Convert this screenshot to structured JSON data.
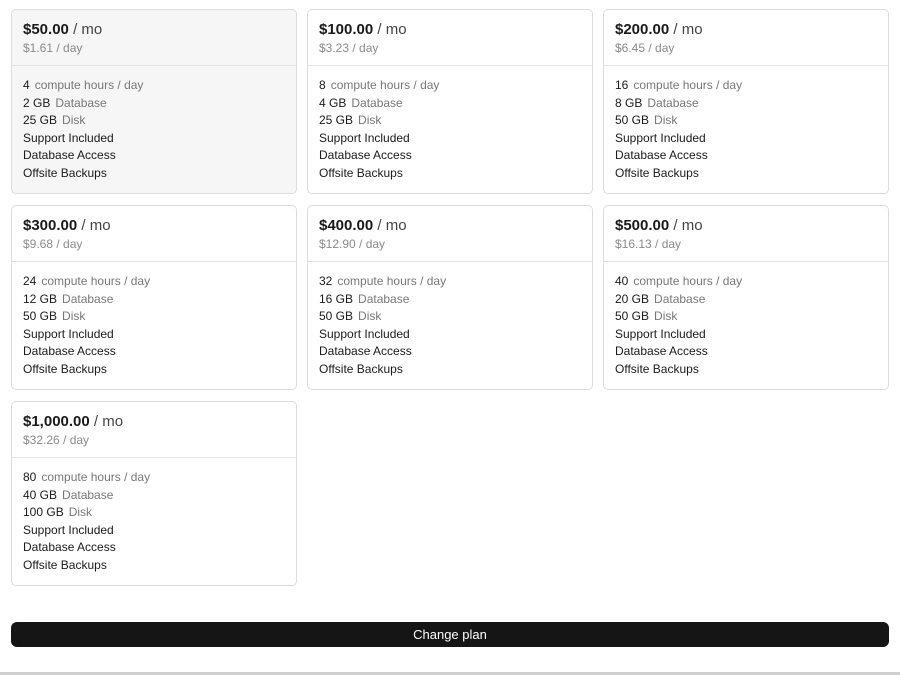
{
  "plans": [
    {
      "price": "$50.00",
      "per_month": "/ mo",
      "per_day": "$1.61 / day",
      "selected": true,
      "features": [
        {
          "value": "4",
          "label": "compute hours / day"
        },
        {
          "value": "2 GB",
          "label": "Database"
        },
        {
          "value": "25 GB",
          "label": "Disk"
        },
        {
          "text": "Support Included"
        },
        {
          "text": "Database Access"
        },
        {
          "text": "Offsite Backups"
        }
      ]
    },
    {
      "price": "$100.00",
      "per_month": "/ mo",
      "per_day": "$3.23 / day",
      "selected": false,
      "features": [
        {
          "value": "8",
          "label": "compute hours / day"
        },
        {
          "value": "4 GB",
          "label": "Database"
        },
        {
          "value": "25 GB",
          "label": "Disk"
        },
        {
          "text": "Support Included"
        },
        {
          "text": "Database Access"
        },
        {
          "text": "Offsite Backups"
        }
      ]
    },
    {
      "price": "$200.00",
      "per_month": "/ mo",
      "per_day": "$6.45 / day",
      "selected": false,
      "features": [
        {
          "value": "16",
          "label": "compute hours / day"
        },
        {
          "value": "8 GB",
          "label": "Database"
        },
        {
          "value": "50 GB",
          "label": "Disk"
        },
        {
          "text": "Support Included"
        },
        {
          "text": "Database Access"
        },
        {
          "text": "Offsite Backups"
        }
      ]
    },
    {
      "price": "$300.00",
      "per_month": "/ mo",
      "per_day": "$9.68 / day",
      "selected": false,
      "features": [
        {
          "value": "24",
          "label": "compute hours / day"
        },
        {
          "value": "12 GB",
          "label": "Database"
        },
        {
          "value": "50 GB",
          "label": "Disk"
        },
        {
          "text": "Support Included"
        },
        {
          "text": "Database Access"
        },
        {
          "text": "Offsite Backups"
        }
      ]
    },
    {
      "price": "$400.00",
      "per_month": "/ mo",
      "per_day": "$12.90 / day",
      "selected": false,
      "features": [
        {
          "value": "32",
          "label": "compute hours / day"
        },
        {
          "value": "16 GB",
          "label": "Database"
        },
        {
          "value": "50 GB",
          "label": "Disk"
        },
        {
          "text": "Support Included"
        },
        {
          "text": "Database Access"
        },
        {
          "text": "Offsite Backups"
        }
      ]
    },
    {
      "price": "$500.00",
      "per_month": "/ mo",
      "per_day": "$16.13 / day",
      "selected": false,
      "features": [
        {
          "value": "40",
          "label": "compute hours / day"
        },
        {
          "value": "20 GB",
          "label": "Database"
        },
        {
          "value": "50 GB",
          "label": "Disk"
        },
        {
          "text": "Support Included"
        },
        {
          "text": "Database Access"
        },
        {
          "text": "Offsite Backups"
        }
      ]
    },
    {
      "price": "$1,000.00",
      "per_month": "/ mo",
      "per_day": "$32.26 / day",
      "selected": false,
      "features": [
        {
          "value": "80",
          "label": "compute hours / day"
        },
        {
          "value": "40 GB",
          "label": "Database"
        },
        {
          "value": "100 GB",
          "label": "Disk"
        },
        {
          "text": "Support Included"
        },
        {
          "text": "Database Access"
        },
        {
          "text": "Offsite Backups"
        }
      ]
    }
  ],
  "actions": {
    "change_plan_label": "Change plan"
  },
  "colors": {
    "button_bg": "#151515",
    "selected_card_bg": "#f6f6f6",
    "card_border": "#dcdcdc",
    "muted_text": "#8a8a8a"
  }
}
